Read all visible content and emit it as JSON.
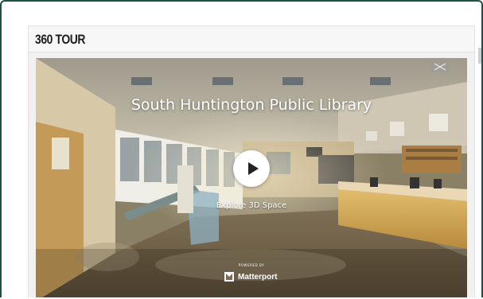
{
  "section": {
    "title": "360 TOUR"
  },
  "viewer": {
    "title": "South Huntington Public Library",
    "explore_label": "Explore 3D Space",
    "powered_by": "POWERED BY",
    "brand": "Matterport",
    "play_icon": "play-icon",
    "brand_icon": "matterport-logo-icon",
    "expand_icon": "expand-icon"
  },
  "colors": {
    "frame_border": "#1a5346",
    "panel_bg": "#f1f1f1",
    "play_button": "#ffffff"
  }
}
